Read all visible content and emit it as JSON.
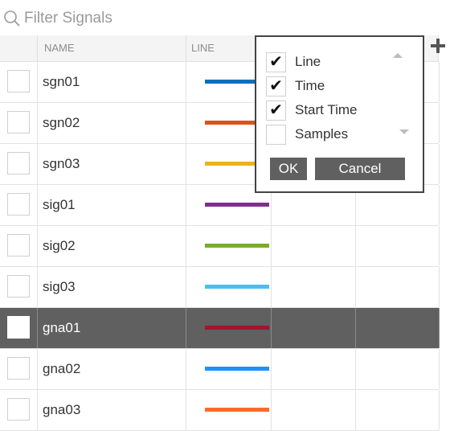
{
  "search": {
    "placeholder": "Filter Signals"
  },
  "table": {
    "headers": {
      "name": "NAME",
      "line": "LINE"
    },
    "rows": [
      {
        "name": "sgn01",
        "color": "#0072bd",
        "selected": false
      },
      {
        "name": "sgn02",
        "color": "#d95319",
        "selected": false
      },
      {
        "name": "sgn03",
        "color": "#edb120",
        "selected": false
      },
      {
        "name": "sig01",
        "color": "#7e2f8e",
        "selected": false
      },
      {
        "name": "sig02",
        "color": "#77ac30",
        "selected": false
      },
      {
        "name": "sig03",
        "color": "#4dbeee",
        "selected": false
      },
      {
        "name": "gna01",
        "color": "#a2142f",
        "selected": true
      },
      {
        "name": "gna02",
        "color": "#1e90ff",
        "selected": false
      },
      {
        "name": "gna03",
        "color": "#ff6a2b",
        "selected": false
      }
    ]
  },
  "column_picker": {
    "options": [
      {
        "label": "Line",
        "checked": true
      },
      {
        "label": "Time",
        "checked": true
      },
      {
        "label": "Start Time",
        "checked": true
      },
      {
        "label": "Samples",
        "checked": false
      }
    ],
    "ok_label": "OK",
    "cancel_label": "Cancel"
  },
  "icons": {
    "search": "magnifier-icon",
    "add": "plus-icon",
    "check": "checkmark-icon"
  }
}
